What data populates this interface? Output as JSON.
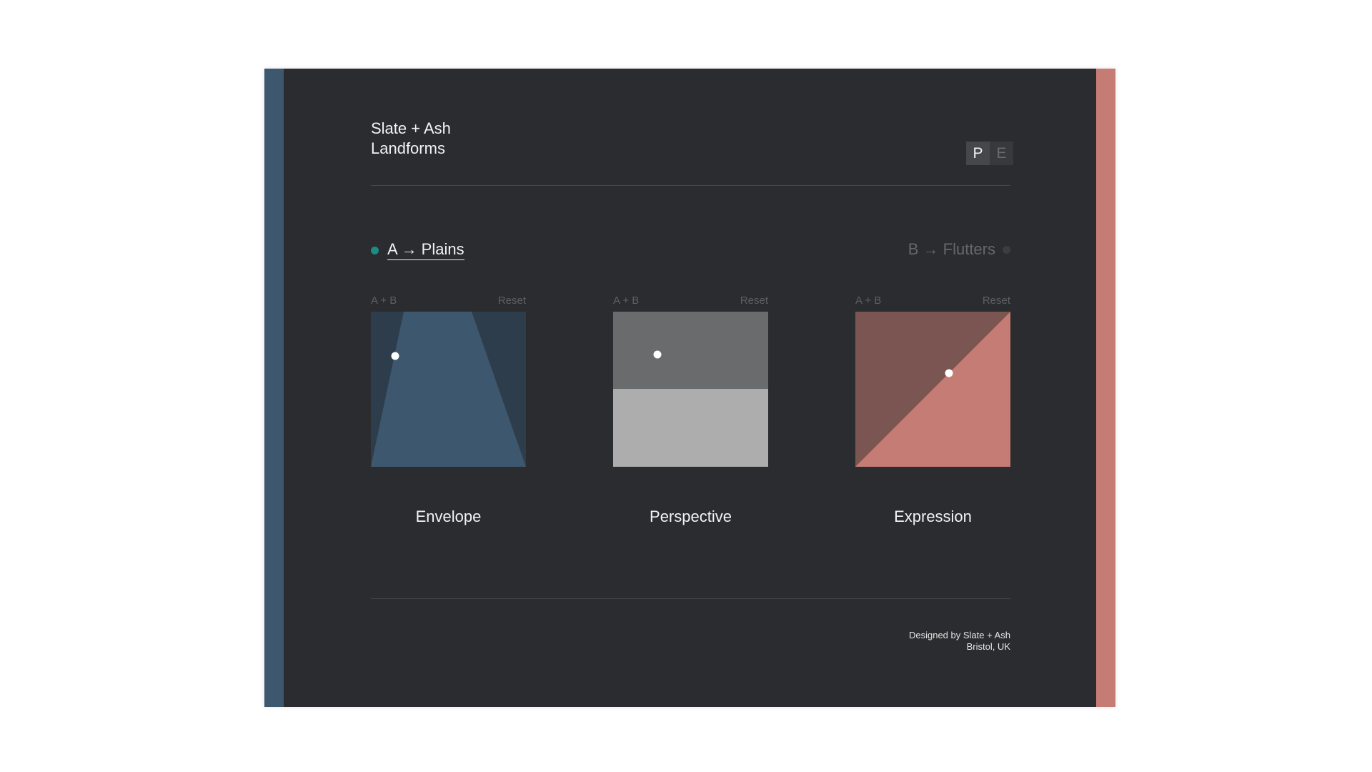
{
  "app": {
    "brand_line1": "Slate + Ash",
    "brand_line2": "Landforms"
  },
  "toggle": {
    "options": [
      "P",
      "E"
    ],
    "selected": "P"
  },
  "modes": {
    "a": {
      "label": "A → Plains",
      "dot_color": "#1a8c84",
      "active": true
    },
    "b": {
      "label": "B → Flutters",
      "dot_color": "#3c3d42",
      "active": false
    }
  },
  "panels": [
    {
      "controls_left": "A + B",
      "controls_right": "Reset",
      "title": "Envelope",
      "colors": [
        "#2e3d4c",
        "#3d586e"
      ]
    },
    {
      "controls_left": "A + B",
      "controls_right": "Reset",
      "title": "Perspective",
      "colors": [
        "#6a6b6d",
        "#adadad"
      ]
    },
    {
      "controls_left": "A + B",
      "controls_right": "Reset",
      "title": "Expression",
      "colors": [
        "#7a5551",
        "#c57c74"
      ]
    }
  ],
  "footer": {
    "line1": "Designed by Slate + Ash",
    "line2": "Bristol, UK"
  },
  "theme": {
    "background": "#2b2c2f",
    "strip_left": "#3d586e",
    "strip_right": "#c57c74"
  }
}
